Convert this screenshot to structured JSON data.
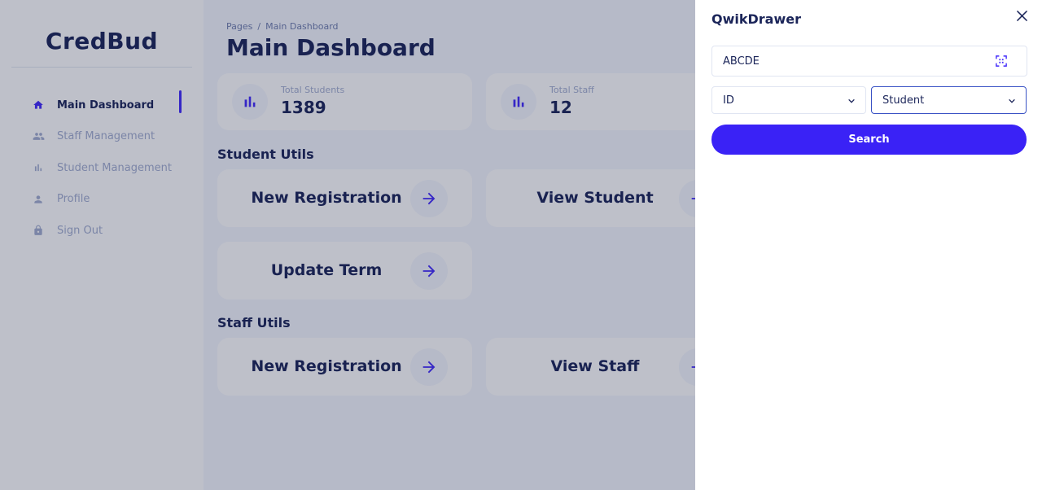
{
  "app": {
    "logo": "CredBud"
  },
  "sidebar": {
    "items": [
      {
        "label": "Main Dashboard",
        "icon": "home-icon"
      },
      {
        "label": "Staff Management",
        "icon": "people-icon"
      },
      {
        "label": "Student Management",
        "icon": "bar-chart-icon"
      },
      {
        "label": "Profile",
        "icon": "person-icon"
      },
      {
        "label": "Sign Out",
        "icon": "lock-icon"
      }
    ],
    "active_index": 0
  },
  "header": {
    "breadcrumb_root": "Pages",
    "breadcrumb_separator": "/",
    "breadcrumb_current": "Main Dashboard",
    "title": "Main Dashboard"
  },
  "stats": [
    {
      "label": "Total Students",
      "value": "1389"
    },
    {
      "label": "Total Staff",
      "value": "12"
    }
  ],
  "student_utils": {
    "title": "Student Utils",
    "actions": [
      "New Registration",
      "View Student",
      "Update Term"
    ]
  },
  "staff_utils": {
    "title": "Staff Utils",
    "actions": [
      "New Registration",
      "View Staff"
    ]
  },
  "drawer": {
    "title": "QwikDrawer",
    "input_value": "ABCDE",
    "id_type_select": "ID",
    "entity_select": "Student",
    "search_label": "Search"
  },
  "colors": {
    "accent": "#422afb",
    "button": "#3a22f6",
    "text_dark": "#1b2559",
    "text_muted": "#a3aed0"
  }
}
